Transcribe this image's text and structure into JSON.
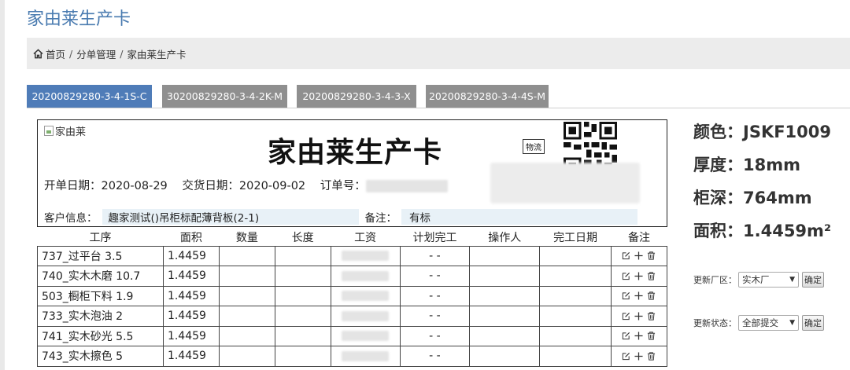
{
  "page": {
    "title": "家由莱生产卡"
  },
  "breadcrumb": {
    "home": "首页",
    "sep": "/",
    "level1": "分单管理",
    "level2": "家由莱生产卡"
  },
  "tabs": [
    {
      "label": "20200829280-3-4-1S-C",
      "active": true
    },
    {
      "label": "30200829280-3-4-2K-M",
      "active": false
    },
    {
      "label": "20200829280-3-4-3-X",
      "active": false
    },
    {
      "label": "20200829280-3-4-4S-M",
      "active": false
    }
  ],
  "card": {
    "logo_alt": "家由莱",
    "title": "家由莱生产卡",
    "wuliu_label": "物流",
    "open_date": "开单日期：2020-08-29",
    "delivery_date": "交货日期：2020-09-02",
    "order_label": "订单号：",
    "customer_label": "客户信息：",
    "customer_value": "趣家测试()吊柜标配薄背板(2-1)",
    "remark_label": "备注：",
    "remark_value": "有标"
  },
  "table": {
    "headers": [
      "工序",
      "面积",
      "数量",
      "长度",
      "工资",
      "计划完工",
      "操作人",
      "完工日期",
      "备注"
    ],
    "rows": [
      {
        "process": "737_过平台 3.5",
        "area": "1.4459",
        "plan": "- -"
      },
      {
        "process": "740_实木木磨 10.7",
        "area": "1.4459",
        "plan": "- -"
      },
      {
        "process": "503_橱柜下料 1.9",
        "area": "1.4459",
        "plan": "- -"
      },
      {
        "process": "733_实木泡油 2",
        "area": "1.4459",
        "plan": "- -"
      },
      {
        "process": "741_实木砂光 5.5",
        "area": "1.4459",
        "plan": "- -"
      },
      {
        "process": "743_实木擦色 5",
        "area": "1.4459",
        "plan": "- -"
      }
    ]
  },
  "specs": {
    "color": "颜色：JSKF1009",
    "thickness": "厚度：18mm",
    "depth": "柜深：764mm",
    "area": "面积：1.4459m²"
  },
  "controls": {
    "factory_label": "更新厂区：",
    "factory_value": "实木厂",
    "status_label": "更新状态：",
    "status_value": "全部提交",
    "confirm_label": "确定"
  }
}
